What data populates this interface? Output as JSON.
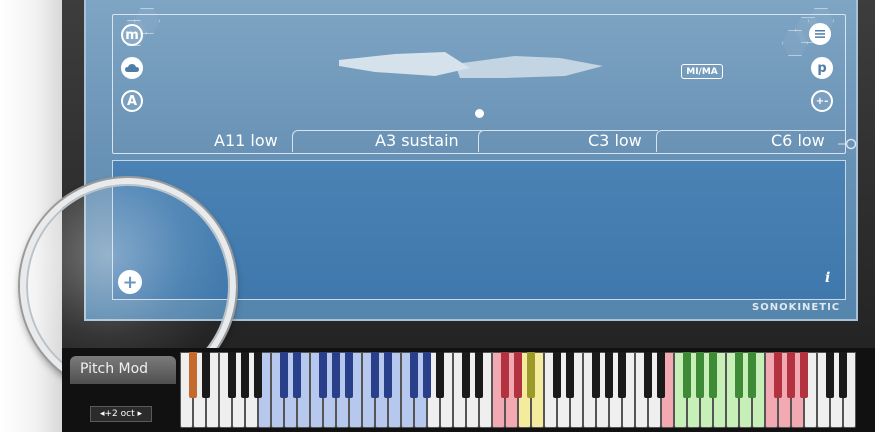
{
  "articulations": {
    "labels": [
      "A11 low",
      "A3 sustain",
      "C3 low",
      "C6 low"
    ]
  },
  "side_buttons": {
    "left": [
      "m",
      "",
      "A"
    ],
    "right": [
      "",
      "p",
      "+-"
    ]
  },
  "mima_label": "MI/MA",
  "info_label": "i",
  "brand": "SONOKINETIC",
  "keyboard": {
    "pitch_tab_label": "Pitch Mod",
    "octave_label": "◂+2 oct ▸",
    "colors": {
      "white_default": "#efefef",
      "black_default": "#1a1a1a",
      "blue_white": "#b7c8ee",
      "blue_black": "#2a3f8a",
      "red_white": "#f3a9b2",
      "red_black": "#b2323f",
      "yellow_white": "#f4ec9c",
      "yellow_black": "#9c9a2a",
      "green_white": "#c6f0b8",
      "green_black": "#3f8a36",
      "orange_black": "#c46a2d"
    }
  },
  "colors": {
    "panel_top": "#7fa5c4",
    "panel_bottom": "#3f78ac",
    "frame": "#2a2a2a"
  }
}
